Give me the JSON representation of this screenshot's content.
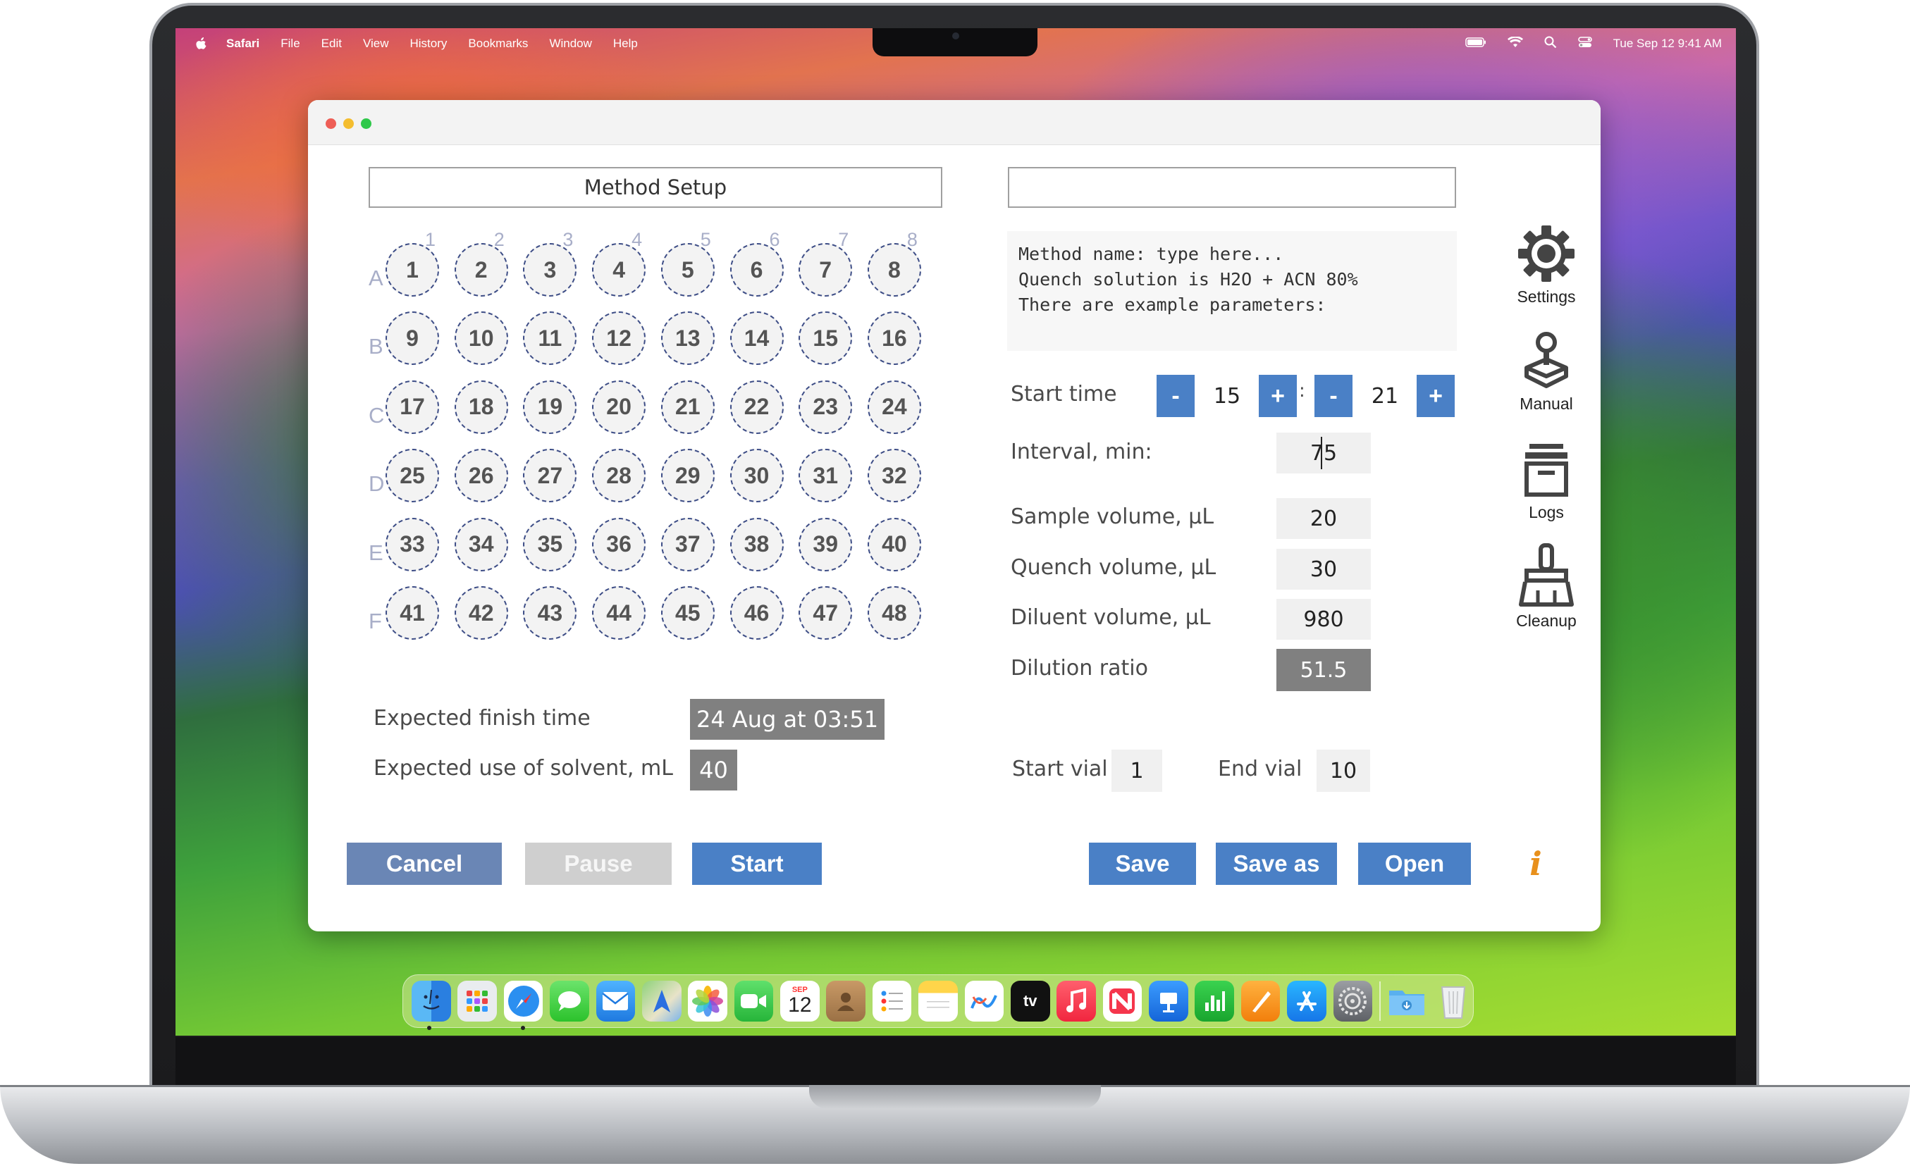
{
  "menubar": {
    "app": "Safari",
    "items": [
      "File",
      "Edit",
      "View",
      "History",
      "Bookmarks",
      "Window",
      "Help"
    ],
    "datetime": "Tue Sep 12  9:41 AM"
  },
  "window": {
    "title_field": "Method Setup",
    "method_name_value": ""
  },
  "plate": {
    "columns": [
      "1",
      "2",
      "3",
      "4",
      "5",
      "6",
      "7",
      "8"
    ],
    "rows": [
      "A",
      "B",
      "C",
      "D",
      "E",
      "F"
    ],
    "wells": [
      "1",
      "2",
      "3",
      "4",
      "5",
      "6",
      "7",
      "8",
      "9",
      "10",
      "11",
      "12",
      "13",
      "14",
      "15",
      "16",
      "17",
      "18",
      "19",
      "20",
      "21",
      "22",
      "23",
      "24",
      "25",
      "26",
      "27",
      "28",
      "29",
      "30",
      "31",
      "32",
      "33",
      "34",
      "35",
      "36",
      "37",
      "38",
      "39",
      "40",
      "41",
      "42",
      "43",
      "44",
      "45",
      "46",
      "47",
      "48"
    ]
  },
  "notes": {
    "line1": "Method name: type here...",
    "line2": "Quench solution is H2O + ACN 80%",
    "line3": "There are example parameters:"
  },
  "params": {
    "start_time_label": "Start time",
    "start_hour": "15",
    "start_minute": "21",
    "minus_label": "-",
    "plus_label": "+",
    "colon": ":",
    "interval_label": "Interval, min:",
    "interval_value": "75",
    "sample_label": "Sample volume, µL",
    "sample_value": "20",
    "quench_label": "Quench volume, µL",
    "quench_value": "30",
    "diluent_label": "Diluent volume, µL",
    "diluent_value": "980",
    "ratio_label": "Dilution ratio",
    "ratio_value": "51.5",
    "start_vial_label": "Start vial",
    "start_vial_value": "1",
    "end_vial_label": "End vial",
    "end_vial_value": "10"
  },
  "summary": {
    "finish_label": "Expected finish time",
    "finish_value": "24 Aug at 03:51",
    "solvent_label": "Expected use of solvent, mL",
    "solvent_value": "40"
  },
  "buttons": {
    "cancel": "Cancel",
    "pause": "Pause",
    "start": "Start",
    "save": "Save",
    "save_as": "Save as",
    "open": "Open",
    "info": "i"
  },
  "sidebar": {
    "settings": "Settings",
    "manual": "Manual",
    "logs": "Logs",
    "cleanup": "Cleanup"
  },
  "dock": {
    "calendar_month": "SEP",
    "calendar_day": "12",
    "tv_label": "tv",
    "icons": [
      "finder-icon",
      "launchpad-icon",
      "safari-icon",
      "messages-icon",
      "mail-icon",
      "maps-icon",
      "photos-icon",
      "facetime-icon",
      "calendar-icon",
      "contacts-icon",
      "reminders-icon",
      "notes-icon",
      "freeform-icon",
      "tv-icon",
      "music-icon",
      "news-icon",
      "keynote-icon",
      "numbers-icon",
      "pages-icon",
      "app-store-icon",
      "system-settings-icon",
      "downloads-folder-icon",
      "trash-icon"
    ]
  },
  "colors": {
    "button_blue": "#4a80c6",
    "button_gray_blue": "#6a86b5",
    "button_disabled": "#cfcfcf",
    "info_orange": "#e8901c",
    "readonly_dark": "#808080"
  }
}
